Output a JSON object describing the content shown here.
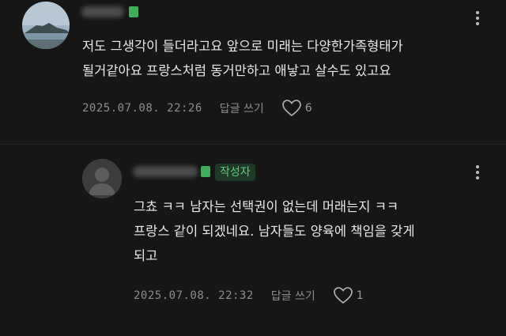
{
  "comments": [
    {
      "text": "저도 그생각이 들더라고요 앞으로 미래는 다양한가족형태가\n될거같아요 프랑스처럼 동거만하고 애낳고 살수도 있고요",
      "date": "2025.07.08. 22:26",
      "reply_label": "답글 쓰기",
      "likes": "6"
    },
    {
      "author_badge": "작성자",
      "text": "그쵸 ㅋㅋ 남자는 선택권이 없는데 머래는지 ㅋㅋ\n프랑스 같이 되겠네요. 남자들도 양육에 책임을 갖게\n되고",
      "date": "2025.07.08. 22:32",
      "reply_label": "답글 쓰기",
      "likes": "1"
    }
  ],
  "colors": {
    "background": "#161616",
    "author_badge_text": "#5fcf7b",
    "verified_green": "#3fae5a"
  }
}
